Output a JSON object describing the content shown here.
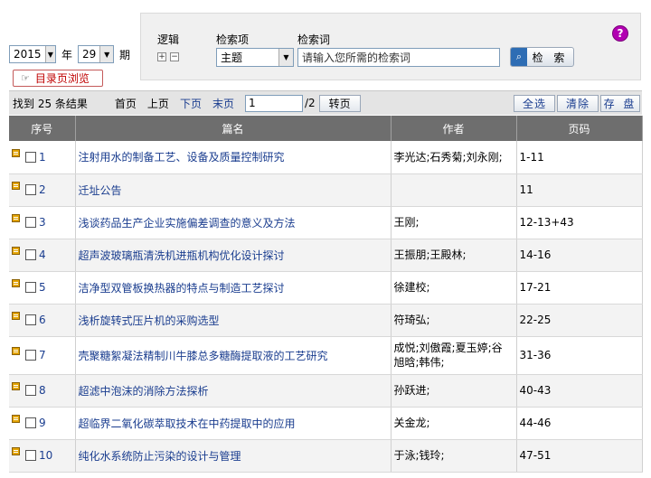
{
  "issue": {
    "year": "2015",
    "year_label": "年",
    "number": "29",
    "number_label": "期"
  },
  "catalog_button": "目录页浏览",
  "search": {
    "logic_label": "逻辑",
    "field_label": "检索项",
    "keyword_label": "检索词",
    "field_value": "主题",
    "keyword_value": "请输入您所需的检索词",
    "button_label": "检 索",
    "plus": "+",
    "minus": "−",
    "help": "?"
  },
  "toolbar": {
    "found": "找到 25 条结果",
    "first": "首页",
    "prev": "上页",
    "next": "下页",
    "last": "末页",
    "page_value": "1",
    "page_total": "/2",
    "go": "转页",
    "select_all": "全选",
    "clear": "清除",
    "save": "存 盘"
  },
  "table": {
    "headers": [
      "序号",
      "篇名",
      "作者",
      "页码"
    ],
    "rows": [
      {
        "num": "1",
        "title": "注射用水的制备工艺、设备及质量控制研究",
        "author": "李光达;石秀菊;刘永刚;",
        "pages": "1-11"
      },
      {
        "num": "2",
        "title": "迁址公告",
        "author": "",
        "pages": "11"
      },
      {
        "num": "3",
        "title": "浅谈药品生产企业实施偏差调查的意义及方法",
        "author": "王刚;",
        "pages": "12-13+43"
      },
      {
        "num": "4",
        "title": "超声波玻璃瓶清洗机进瓶机构优化设计探讨",
        "author": "王振朋;王殿林;",
        "pages": "14-16"
      },
      {
        "num": "5",
        "title": "洁净型双管板换热器的特点与制造工艺探讨",
        "author": "徐建校;",
        "pages": "17-21"
      },
      {
        "num": "6",
        "title": "浅析旋转式压片机的采购选型",
        "author": "符琦弘;",
        "pages": "22-25"
      },
      {
        "num": "7",
        "title": "壳聚糖絮凝法精制川牛膝总多糖酶提取液的工艺研究",
        "author": "成悦;刘傲霞;夏玉婷;谷旭晗;韩伟;",
        "pages": "31-36"
      },
      {
        "num": "8",
        "title": "超滤中泡沫的消除方法探析",
        "author": "孙跃进;",
        "pages": "40-43"
      },
      {
        "num": "9",
        "title": "超临界二氧化碳萃取技术在中药提取中的应用",
        "author": "关金龙;",
        "pages": "44-46"
      },
      {
        "num": "10",
        "title": "纯化水系统防止污染的设计与管理",
        "author": "于泳;钱玲;",
        "pages": "47-51"
      }
    ]
  }
}
